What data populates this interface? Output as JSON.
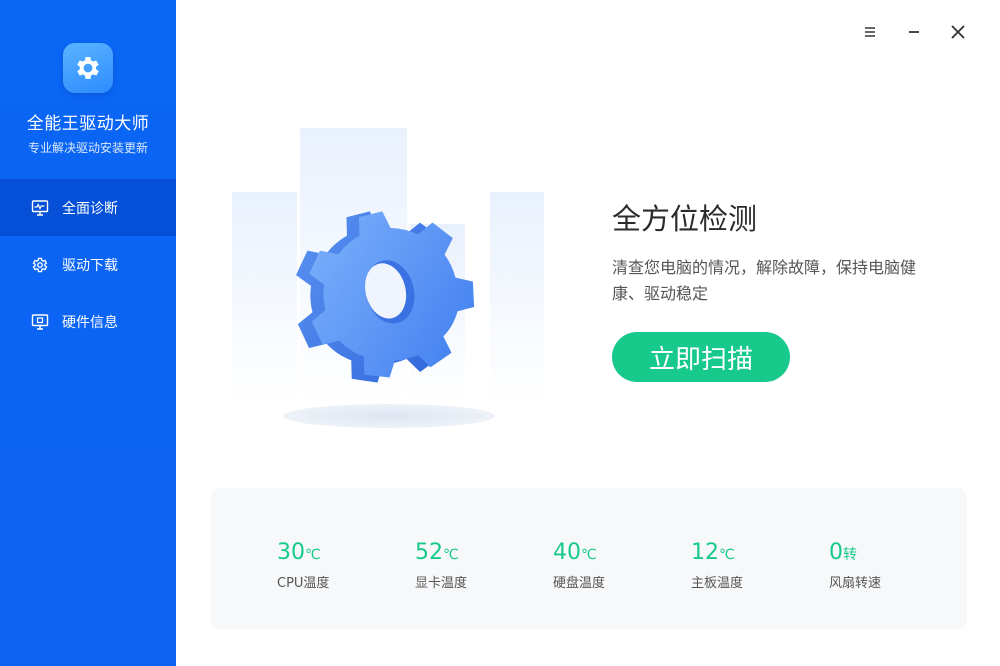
{
  "app": {
    "title": "全能王驱动大师",
    "subtitle": "专业解决驱动安装更新",
    "logo_icon": "gear-icon"
  },
  "colors": {
    "sidebar": "#0a66f5",
    "sidebar_active": "#0550d6",
    "accent_green": "#17c98b",
    "gear_blue": "#4f8ff5"
  },
  "nav": {
    "items": [
      {
        "label": "全面诊断",
        "icon": "monitor-pulse-icon",
        "active": true
      },
      {
        "label": "驱动下载",
        "icon": "gear-cog-icon",
        "active": false
      },
      {
        "label": "硬件信息",
        "icon": "monitor-info-icon",
        "active": false
      }
    ]
  },
  "window_controls": {
    "menu_icon": "menu-icon",
    "minimize_icon": "minimize-icon",
    "close_icon": "close-icon"
  },
  "hero": {
    "title": "全方位检测",
    "description": "清查您电脑的情况，解除故障，保持电脑健康、驱动稳定",
    "button_label": "立即扫描",
    "illustration_icon": "large-gear-icon"
  },
  "stats": [
    {
      "value": "30",
      "unit": "℃",
      "label": "CPU温度"
    },
    {
      "value": "52",
      "unit": "℃",
      "label": "显卡温度"
    },
    {
      "value": "40",
      "unit": "℃",
      "label": "硬盘温度"
    },
    {
      "value": "12",
      "unit": "℃",
      "label": "主板温度"
    },
    {
      "value": "0",
      "unit": "转",
      "label": "风扇转速"
    }
  ]
}
